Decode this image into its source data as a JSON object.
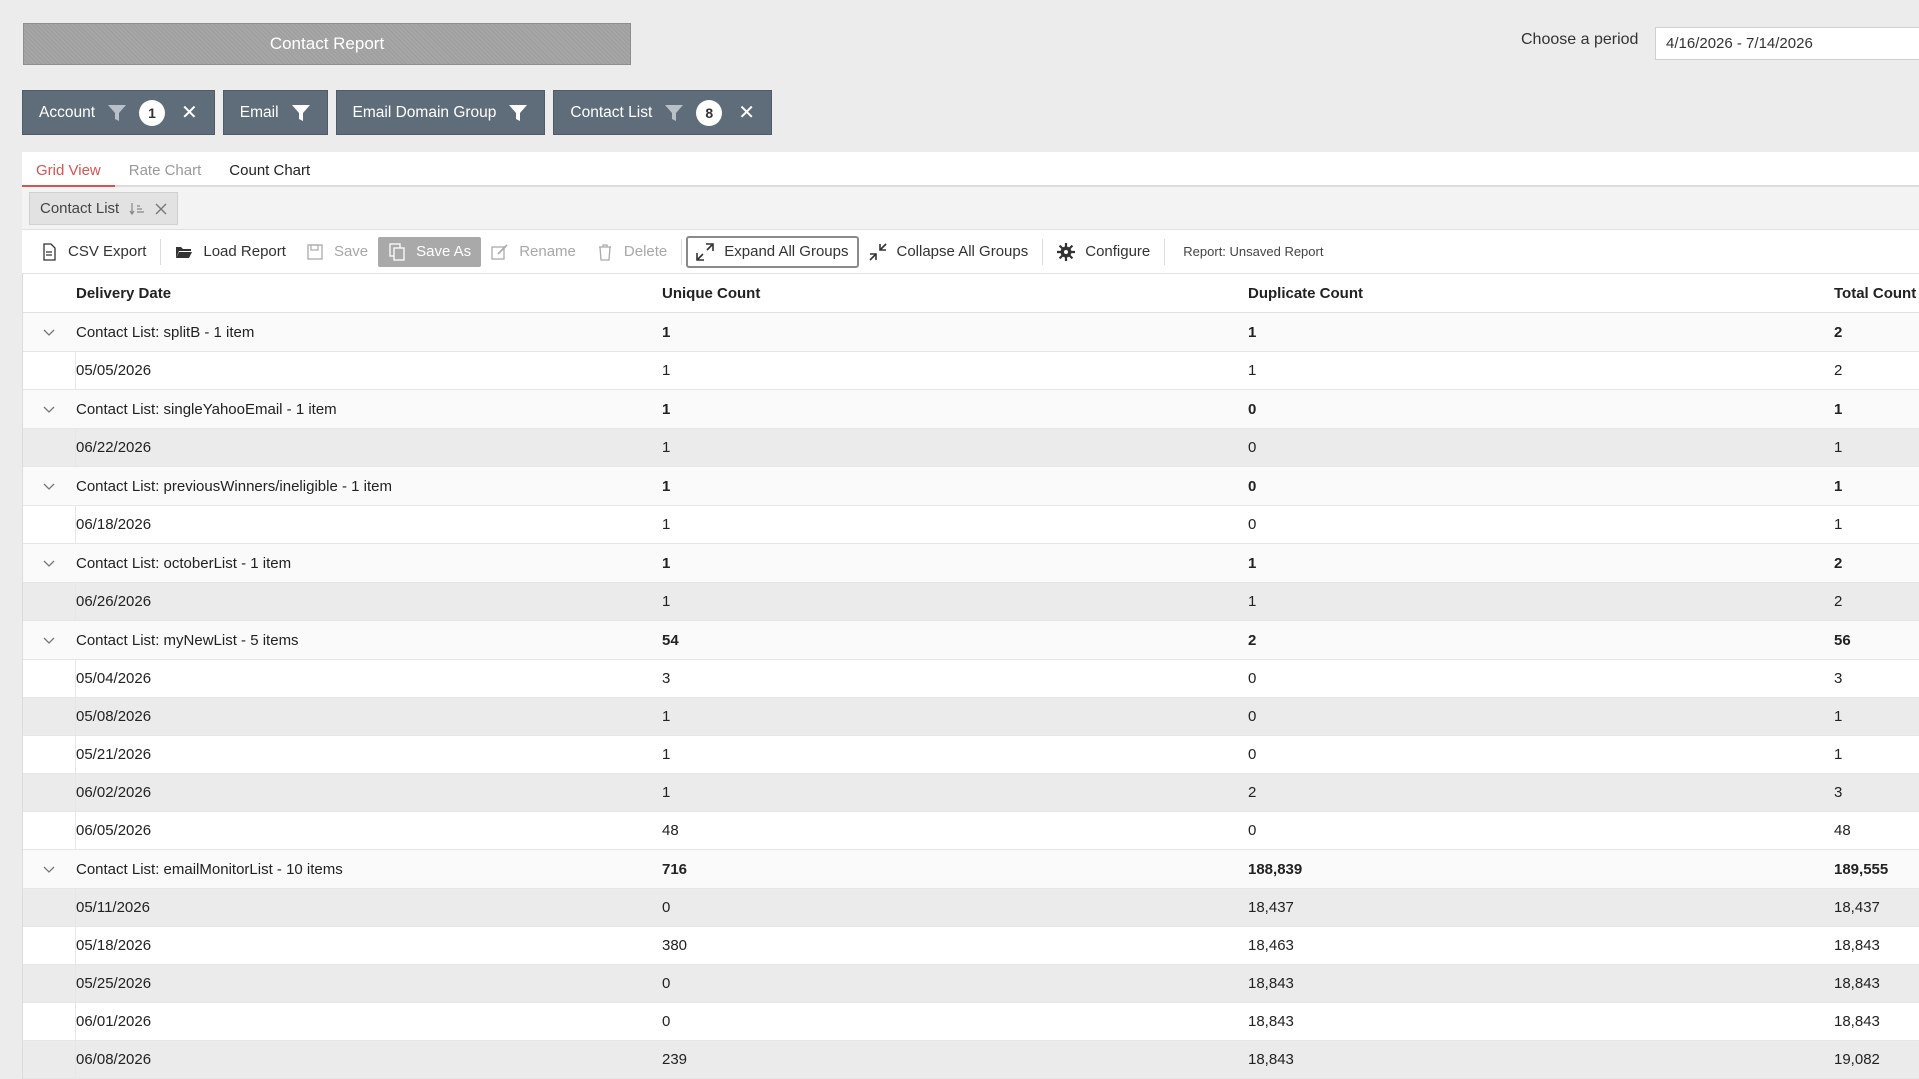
{
  "header": {
    "title": "Contact Report",
    "period_label": "Choose a period",
    "period_value": "4/16/2026 - 7/14/2026"
  },
  "filters": [
    {
      "label": "Account",
      "badge": "1",
      "icon": "funnel-icon",
      "closable": true
    },
    {
      "label": "Email",
      "badge": "",
      "icon": "funnel-icon",
      "closable": false
    },
    {
      "label": "Email Domain Group",
      "badge": "",
      "icon": "funnel-icon",
      "closable": false
    },
    {
      "label": "Contact List",
      "badge": "8",
      "icon": "funnel-icon",
      "closable": true
    }
  ],
  "tabs": {
    "grid": "Grid View",
    "rate": "Rate Chart",
    "count": "Count Chart"
  },
  "grouping": {
    "label": "Contact List"
  },
  "toolbar": {
    "csv_export": "CSV Export",
    "load_report": "Load Report",
    "save": "Save",
    "save_as": "Save As",
    "rename": "Rename",
    "delete": "Delete",
    "expand_all": "Expand All Groups",
    "collapse_all": "Collapse All Groups",
    "configure": "Configure",
    "report_status": "Report: Unsaved Report"
  },
  "grid": {
    "columns": [
      "Delivery Date",
      "Unique Count",
      "Duplicate Count",
      "Total Count"
    ],
    "groups": [
      {
        "label": "Contact List: splitB - 1 item",
        "unique": "1",
        "duplicate": "1",
        "total": "2",
        "rows": [
          {
            "date": "05/05/2026",
            "unique": "1",
            "duplicate": "1",
            "total": "2"
          }
        ]
      },
      {
        "label": "Contact List: singleYahooEmail - 1 item",
        "unique": "1",
        "duplicate": "0",
        "total": "1",
        "rows": [
          {
            "date": "06/22/2026",
            "unique": "1",
            "duplicate": "0",
            "total": "1"
          }
        ]
      },
      {
        "label": "Contact List: previousWinners/ineligible - 1 item",
        "unique": "1",
        "duplicate": "0",
        "total": "1",
        "rows": [
          {
            "date": "06/18/2026",
            "unique": "1",
            "duplicate": "0",
            "total": "1"
          }
        ]
      },
      {
        "label": "Contact List: octoberList - 1 item",
        "unique": "1",
        "duplicate": "1",
        "total": "2",
        "rows": [
          {
            "date": "06/26/2026",
            "unique": "1",
            "duplicate": "1",
            "total": "2"
          }
        ]
      },
      {
        "label": "Contact List: myNewList - 5 items",
        "unique": "54",
        "duplicate": "2",
        "total": "56",
        "rows": [
          {
            "date": "05/04/2026",
            "unique": "3",
            "duplicate": "0",
            "total": "3"
          },
          {
            "date": "05/08/2026",
            "unique": "1",
            "duplicate": "0",
            "total": "1"
          },
          {
            "date": "05/21/2026",
            "unique": "1",
            "duplicate": "0",
            "total": "1"
          },
          {
            "date": "06/02/2026",
            "unique": "1",
            "duplicate": "2",
            "total": "3"
          },
          {
            "date": "06/05/2026",
            "unique": "48",
            "duplicate": "0",
            "total": "48"
          }
        ]
      },
      {
        "label": "Contact List: emailMonitorList - 10 items",
        "unique": "716",
        "duplicate": "188,839",
        "total": "189,555",
        "rows": [
          {
            "date": "05/11/2026",
            "unique": "0",
            "duplicate": "18,437",
            "total": "18,437"
          },
          {
            "date": "05/18/2026",
            "unique": "380",
            "duplicate": "18,463",
            "total": "18,843"
          },
          {
            "date": "05/25/2026",
            "unique": "0",
            "duplicate": "18,843",
            "total": "18,843"
          },
          {
            "date": "06/01/2026",
            "unique": "0",
            "duplicate": "18,843",
            "total": "18,843"
          },
          {
            "date": "06/08/2026",
            "unique": "239",
            "duplicate": "18,843",
            "total": "19,082"
          }
        ]
      }
    ]
  }
}
